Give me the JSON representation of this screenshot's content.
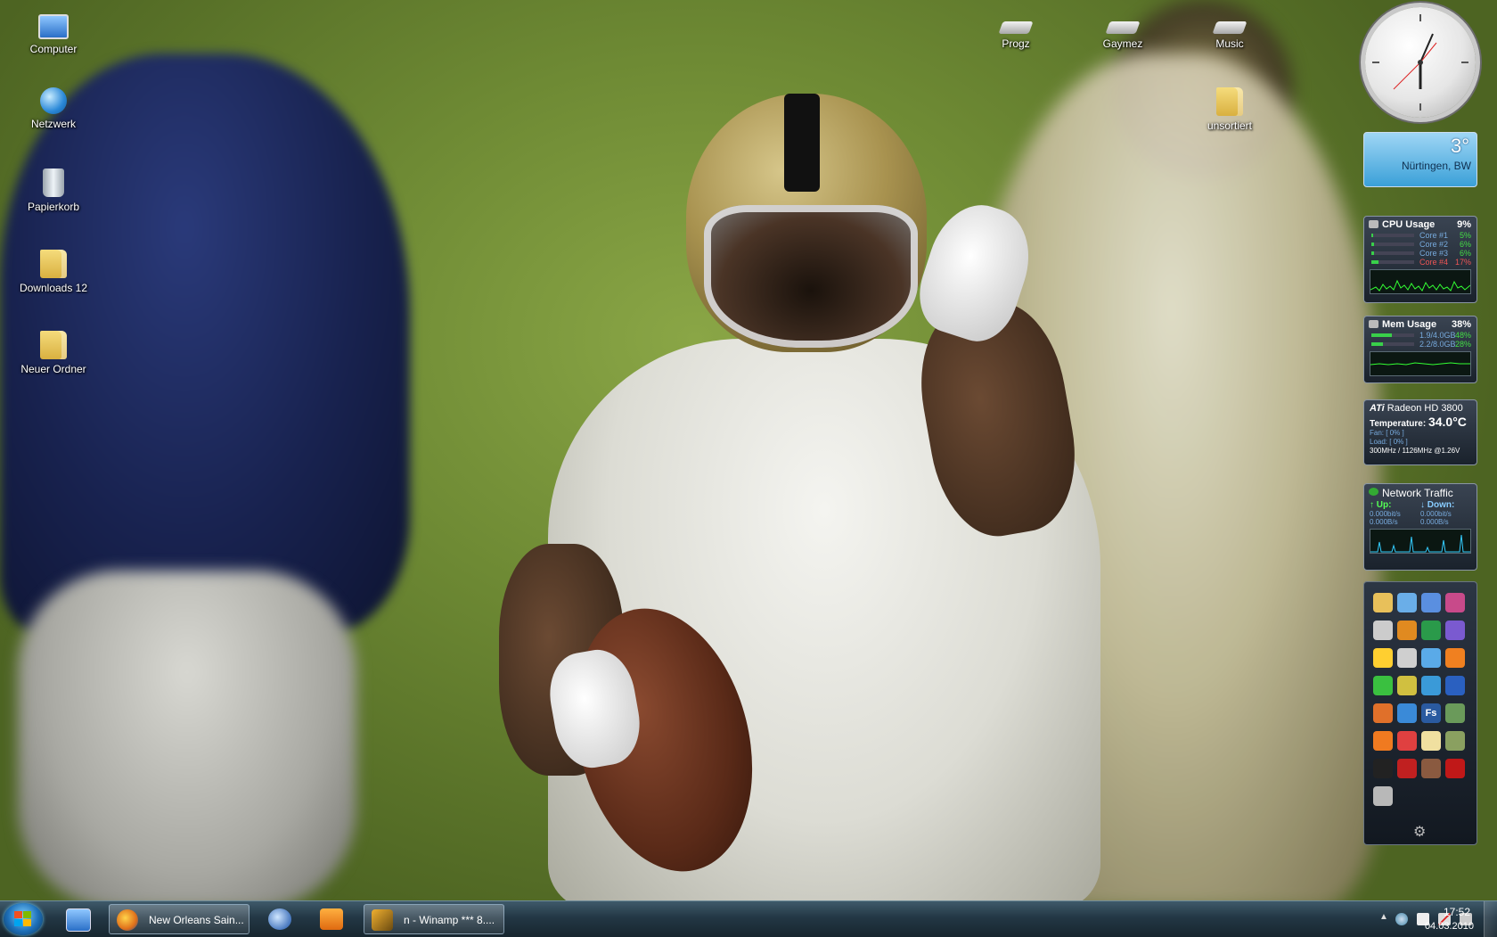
{
  "desktop_icons_left": [
    {
      "label": "Computer",
      "icon": "computer-icon"
    },
    {
      "label": "Netzwerk",
      "icon": "network-icon"
    },
    {
      "label": "Papierkorb",
      "icon": "recycle-bin-icon"
    },
    {
      "label": "Downloads 12",
      "icon": "folder-icon"
    },
    {
      "label": "Neuer Ordner",
      "icon": "folder-icon"
    }
  ],
  "desktop_icons_top": [
    {
      "label": "Progz",
      "icon": "drive-icon"
    },
    {
      "label": "Gaymez",
      "icon": "drive-icon"
    },
    {
      "label": "Music",
      "icon": "drive-icon"
    },
    {
      "label": "unsortiert",
      "icon": "folder-icon"
    }
  ],
  "weather": {
    "temperature": "3°",
    "location": "Nürtingen, BW"
  },
  "cpu": {
    "title": "CPU Usage",
    "total": "9%",
    "cores": [
      {
        "name": "Core #1",
        "value": "5%",
        "fraction": 0.05
      },
      {
        "name": "Core #2",
        "value": "6%",
        "fraction": 0.06
      },
      {
        "name": "Core #3",
        "value": "6%",
        "fraction": 0.06
      },
      {
        "name": "Core #4",
        "value": "17%",
        "fraction": 0.17
      }
    ]
  },
  "mem": {
    "title": "Mem Usage",
    "total": "38%",
    "rows": [
      {
        "name": "1.9/4.0GB",
        "value": "48%",
        "fraction": 0.48
      },
      {
        "name": "2.2/8.0GB",
        "value": "28%",
        "fraction": 0.28
      }
    ]
  },
  "gpu": {
    "brand": "ATi",
    "model": "Radeon HD 3800",
    "temp_label": "Temperature:",
    "temp_value": "34.0°C",
    "fan": "Fan: [ 0% ]",
    "load": "Load: [ 0% ]",
    "clocks": "300MHz / 1126MHz @1.26V"
  },
  "net": {
    "title": "Network Traffic",
    "up_label": "Up:",
    "down_label": "Down:",
    "up_bits": "0.000bit/s",
    "down_bits": "0.000bit/s",
    "up_bytes": "0.000B/s",
    "down_bytes": "0.000B/s"
  },
  "launcher_icons": [
    "explorer-icon",
    "network-places-icon",
    "computer-icon",
    "winrar-icon",
    "drive-icon",
    "info-icon",
    "hardware-icon",
    "winamp-icon",
    "eye-icon",
    "globe-icon",
    "sphere-icon",
    "vlc-icon",
    "clover-icon",
    "lan-icon",
    "messenger-icon",
    "pen-icon",
    "firefox-icon",
    "puzzle-icon",
    "fs-icon",
    "xfire-icon",
    "orange-icon",
    "tools-icon",
    "folder-icon",
    "bonsai-icon",
    "steam-icon",
    "game-icon",
    "soldier-icon",
    "red-disc-icon",
    "display-icon"
  ],
  "launcher_colors": [
    "#e8c05a",
    "#6aaee8",
    "#5a8fe0",
    "#c84a8a",
    "#cccccc",
    "#e08a20",
    "#2a9a4a",
    "#7a5ad0",
    "#ffcf30",
    "#cfcfcf",
    "#5aaae8",
    "#f08020",
    "#3ac040",
    "#d0c040",
    "#3a9ad8",
    "#2a60c0",
    "#e0702a",
    "#3a8ad8",
    "#2a5aa0",
    "#6a9a5a",
    "#f07a20",
    "#e04040",
    "#f0e0a0",
    "#8aa060",
    "#222222",
    "#c02020",
    "#8a5a40",
    "#c01818",
    "#b8b8b8"
  ],
  "launcher_text": {
    "fs-icon": "Fs"
  },
  "taskbar": {
    "tasks": [
      {
        "label": "New Orleans Sain...",
        "icon": "firefox-icon"
      },
      {
        "label": "n - Winamp *** 8....",
        "icon": "winamp-icon"
      }
    ],
    "time": "17:52",
    "date": "04.03.2010"
  },
  "colors": {
    "accent": "#2a6fc7",
    "taskbar": "#233745"
  }
}
